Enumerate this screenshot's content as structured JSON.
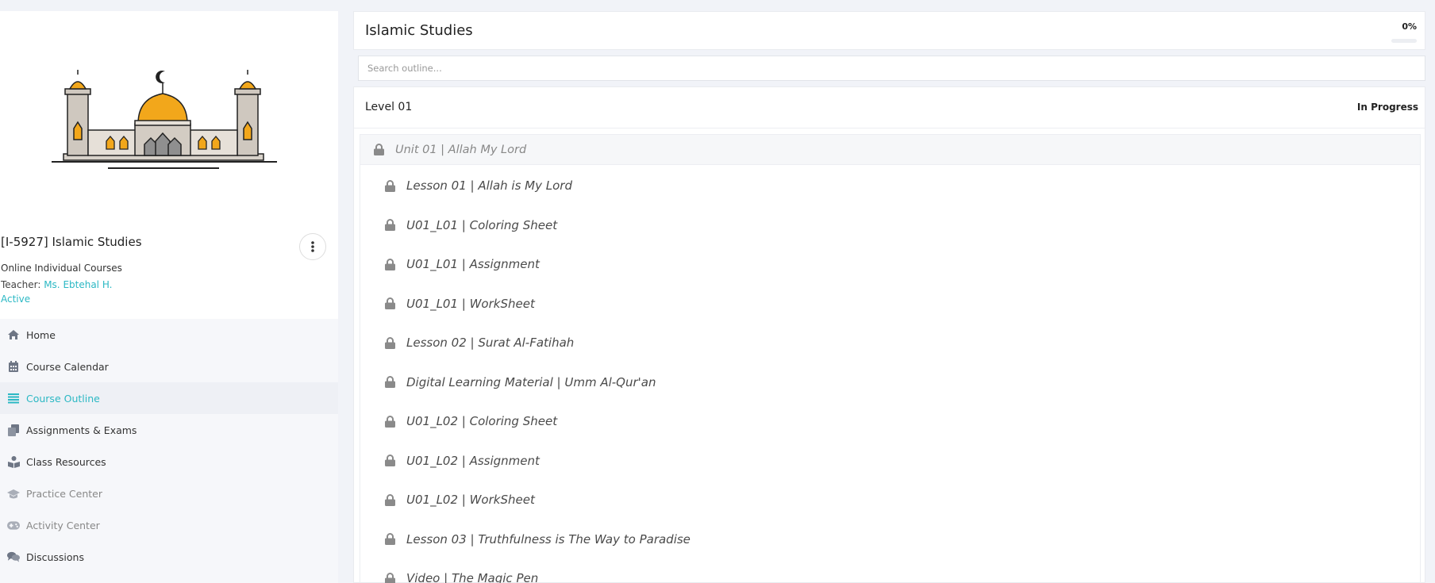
{
  "course": {
    "code_title": "[I-5927] Islamic Studies",
    "type": "Online Individual Courses",
    "teacher_label": "Teacher: ",
    "teacher_name": "Ms. Ebtehal H.",
    "status": "Active"
  },
  "nav": {
    "items": [
      {
        "label": "Home",
        "icon": "home-icon"
      },
      {
        "label": "Course Calendar",
        "icon": "calendar-icon"
      },
      {
        "label": "Course Outline",
        "icon": "list-icon"
      },
      {
        "label": "Assignments & Exams",
        "icon": "copy-icon"
      },
      {
        "label": "Class Resources",
        "icon": "book-reader-icon"
      },
      {
        "label": "Practice Center",
        "icon": "graduation-cap-icon"
      },
      {
        "label": "Activity Center",
        "icon": "gamepad-icon"
      },
      {
        "label": "Discussions",
        "icon": "comments-icon"
      }
    ]
  },
  "header": {
    "title": "Islamic Studies",
    "progress_label": "0%",
    "progress_fraction": 0
  },
  "search": {
    "placeholder": "Search outline..."
  },
  "level": {
    "title": "Level 01",
    "status": "In Progress"
  },
  "unit": {
    "title": "Unit 01 | Allah My Lord",
    "lessons": [
      "Lesson 01 | Allah is My Lord",
      "U01_L01 | Coloring Sheet",
      "U01_L01 | Assignment",
      "U01_L01 | WorkSheet",
      "Lesson 02 | Surat Al-Fatihah",
      "Digital Learning Material | Umm Al-Qur'an",
      "U01_L02 | Coloring Sheet",
      "U01_L02 | Assignment",
      "U01_L02 | WorkSheet",
      "Lesson 03 | Truthfulness is The Way to Paradise",
      "Video | The Magic Pen"
    ]
  },
  "colors": {
    "accent": "#2bb8c4",
    "dome": "#f2a71b",
    "lock": "#8a8a8a"
  }
}
